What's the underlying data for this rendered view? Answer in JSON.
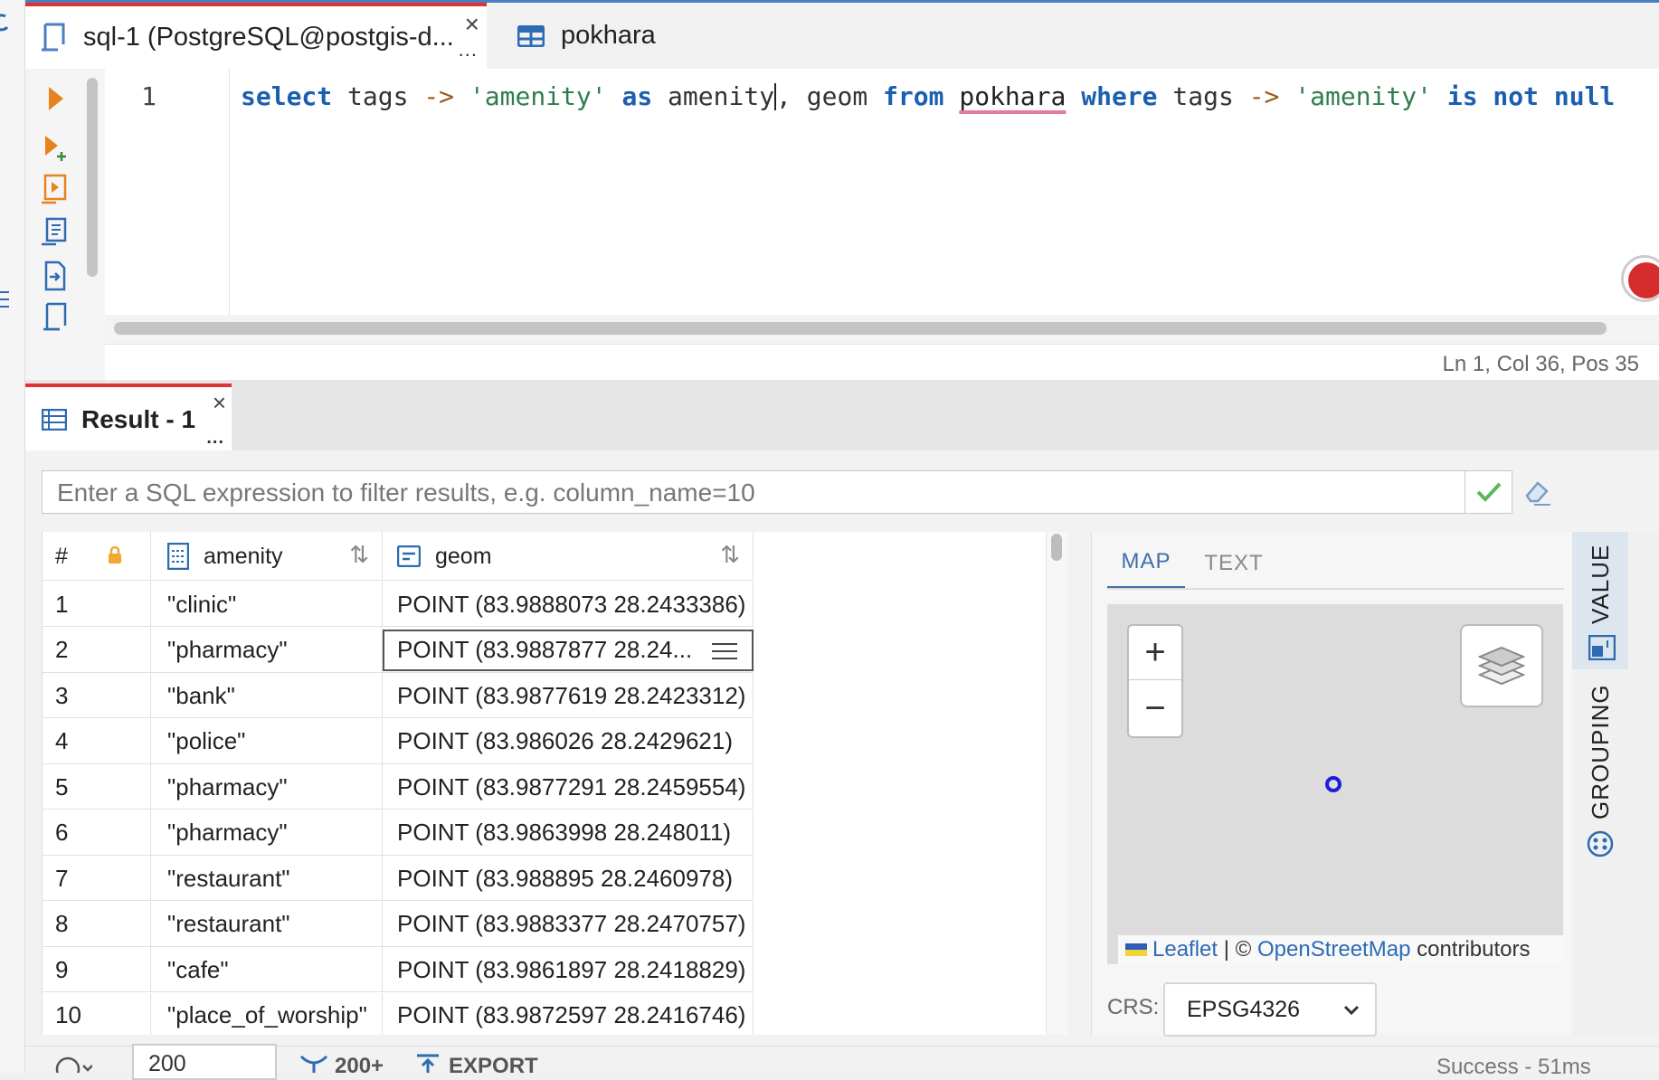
{
  "tabs": [
    {
      "label": "sql-1 (PostgreSQL@postgis-d...",
      "active": true,
      "icon": "sql-script-icon"
    },
    {
      "label": "pokhara",
      "active": false,
      "icon": "table-icon"
    }
  ],
  "tab_more": "...",
  "editor": {
    "line_number": "1",
    "code_tokens": [
      {
        "t": "select",
        "c": "kw"
      },
      {
        "t": " tags ",
        "c": "ident"
      },
      {
        "t": "->",
        "c": "op"
      },
      {
        "t": " ",
        "c": "ident"
      },
      {
        "t": "'amenity'",
        "c": "str"
      },
      {
        "t": " ",
        "c": "ident"
      },
      {
        "t": "as",
        "c": "kw"
      },
      {
        "t": " amenity",
        "c": "ident"
      },
      {
        "t": "|",
        "c": "cursor"
      },
      {
        "t": ", geom ",
        "c": "ident"
      },
      {
        "t": "from",
        "c": "kw"
      },
      {
        "t": " ",
        "c": "ident"
      },
      {
        "t": "pokhara",
        "c": "squiggle"
      },
      {
        "t": " ",
        "c": "ident"
      },
      {
        "t": "where",
        "c": "kw"
      },
      {
        "t": " tags ",
        "c": "ident"
      },
      {
        "t": "->",
        "c": "op"
      },
      {
        "t": " ",
        "c": "ident"
      },
      {
        "t": "'amenity'",
        "c": "str"
      },
      {
        "t": " ",
        "c": "ident"
      },
      {
        "t": "is",
        "c": "kw"
      },
      {
        "t": " ",
        "c": "ident"
      },
      {
        "t": "not",
        "c": "kw"
      },
      {
        "t": " ",
        "c": "ident"
      },
      {
        "t": "null",
        "c": "kw"
      }
    ],
    "status": "Ln 1, Col 36, Pos 35"
  },
  "result_tab": {
    "label": "Result - 1",
    "more": "..."
  },
  "filter": {
    "placeholder": "Enter a SQL expression to filter results, e.g. column_name=10"
  },
  "grid": {
    "columns": {
      "num": "#",
      "amenity": "amenity",
      "geom": "geom"
    },
    "rows": [
      {
        "num": "1",
        "amenity": "\"clinic\"",
        "geom": "POINT (83.9888073 28.2433386)"
      },
      {
        "num": "2",
        "amenity": "\"pharmacy\"",
        "geom": "POINT (83.9887877 28.24..."
      },
      {
        "num": "3",
        "amenity": "\"bank\"",
        "geom": "POINT (83.9877619 28.2423312)"
      },
      {
        "num": "4",
        "amenity": "\"police\"",
        "geom": "POINT (83.986026 28.2429621)"
      },
      {
        "num": "5",
        "amenity": "\"pharmacy\"",
        "geom": "POINT (83.9877291 28.2459554)"
      },
      {
        "num": "6",
        "amenity": "\"pharmacy\"",
        "geom": "POINT (83.9863998 28.248011)"
      },
      {
        "num": "7",
        "amenity": "\"restaurant\"",
        "geom": "POINT (83.988895 28.2460978)"
      },
      {
        "num": "8",
        "amenity": "\"restaurant\"",
        "geom": "POINT (83.9883377 28.2470757)"
      },
      {
        "num": "9",
        "amenity": "\"cafe\"",
        "geom": "POINT (83.9861897 28.2418829)"
      },
      {
        "num": "10",
        "amenity": "\"place_of_worship\"",
        "geom": "POINT (83.9872597 28.2416746)"
      }
    ],
    "selected_row": 2
  },
  "value_panel": {
    "tabs": {
      "map": "MAP",
      "text": "TEXT"
    },
    "zoom_in": "+",
    "zoom_out": "−",
    "attribution": {
      "leaflet": "Leaflet",
      "sep": " | © ",
      "osm": "OpenStreetMap",
      "suffix": " contributors"
    },
    "crs_label": "CRS:",
    "crs_value": "EPSG4326"
  },
  "side_tabs": {
    "value": "VALUE",
    "grouping": "GROUPING"
  },
  "bottom": {
    "limit": "200",
    "count": "200+",
    "export": "EXPORT",
    "status": "Success - 51ms"
  },
  "colors": {
    "accent": "#4a7fc1",
    "active_tab": "#dd3333",
    "keyword": "#1a5fb0",
    "string": "#2e7d4f",
    "run": "#e8821e",
    "map_point": "#1d1de0"
  }
}
